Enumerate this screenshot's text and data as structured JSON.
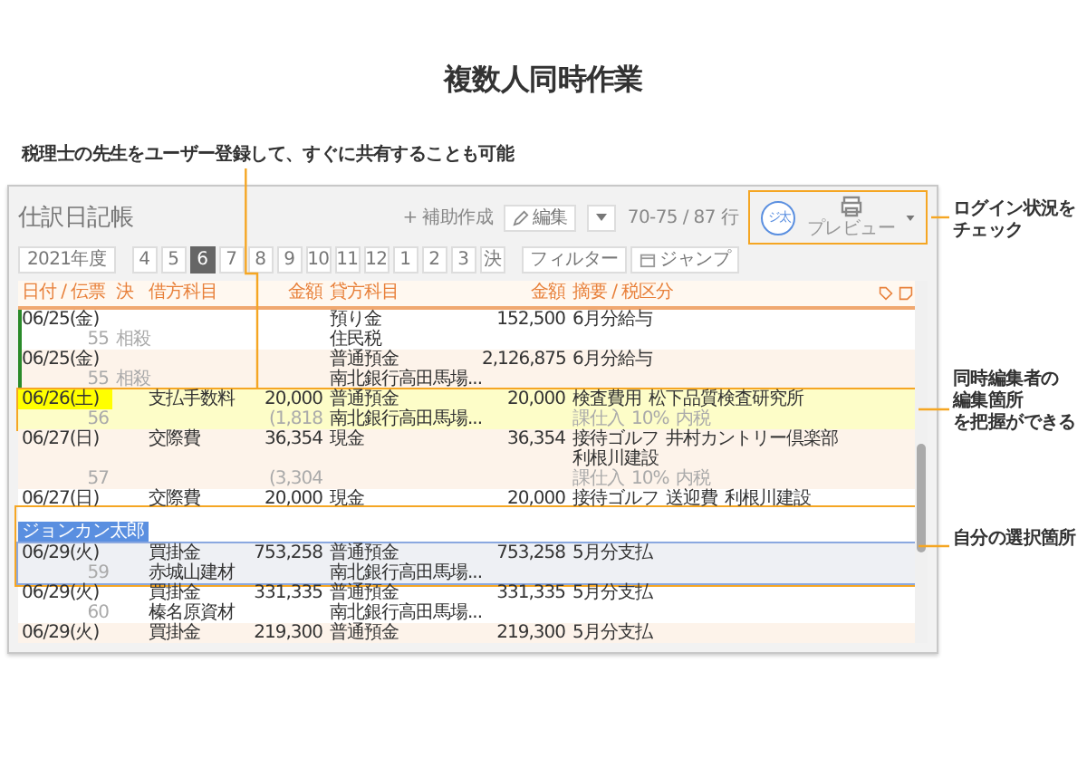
{
  "title": "複数人同時作業",
  "note": "税理士の先生をユーザー登録して、すぐに共有することも可能",
  "callouts": [
    {
      "kind": "login",
      "lines": [
        "ログイン状況を",
        "チェック"
      ]
    },
    {
      "kind": "other",
      "lines": [
        "同時編集者の",
        "編集箇所",
        "を把握ができる"
      ]
    },
    {
      "kind": "self",
      "lines": [
        "自分の選択箇所"
      ]
    }
  ],
  "window": {
    "title": "仕訳日記帳",
    "user_avatar": "ジ太",
    "preview": "プレビュー",
    "add_sub": "+ 補助作成",
    "edit": "編集",
    "row_range": "70-75 / 87 行",
    "fiscal_year": "2021年度",
    "periods": [
      {
        "label": "4",
        "selected": false
      },
      {
        "label": "5",
        "selected": false
      },
      {
        "label": "6",
        "selected": true
      },
      {
        "label": "7",
        "selected": false
      },
      {
        "label": "8",
        "selected": false
      },
      {
        "label": "9",
        "selected": false
      },
      {
        "label": "10",
        "selected": false
      },
      {
        "label": "11",
        "selected": false
      },
      {
        "label": "12",
        "selected": false
      },
      {
        "label": "1",
        "selected": false
      },
      {
        "label": "2",
        "selected": false
      },
      {
        "label": "3",
        "selected": false
      },
      {
        "label": "決",
        "selected": false
      }
    ],
    "filter": "フィルター",
    "jump": "ジャンプ"
  },
  "table": {
    "columns": [
      "日付 / 伝票",
      "決",
      "借方科目",
      "金額",
      "貸方科目",
      "金額",
      "摘要 / 税区分"
    ],
    "entries": [
      {
        "date": "06/25(金)",
        "slip": "55",
        "settle": "相殺",
        "credit": "預り金",
        "credit_amount": "152,500",
        "credit_sub": "住民税",
        "memo": [
          "6月分給与"
        ],
        "edited_by_other": false,
        "selected": false,
        "left_marker": true
      },
      {
        "date": "06/25(金)",
        "slip": "55",
        "settle": "相殺",
        "credit": "普通預金",
        "credit_amount": "2,126,875",
        "credit_sub": "南北銀行高田馬場...",
        "memo": [
          "6月分給与"
        ],
        "edited_by_other": false,
        "selected": false,
        "left_marker": true
      },
      {
        "date": "06/26(土)",
        "slip": "56",
        "debit": "支払手数料",
        "debit_amount": "20,000",
        "debit_tax": "(1,818",
        "credit": "普通預金",
        "credit_amount": "20,000",
        "credit_sub": "南北銀行高田馬場...",
        "memo": [
          "検査費用",
          "松下品質検査研究所"
        ],
        "tax": [
          "課仕入",
          "10%",
          "内税"
        ],
        "edited_by_other": true,
        "selected": false,
        "left_marker": false
      },
      {
        "date": "06/27(日)",
        "slip": "57",
        "debit": "交際費",
        "debit_amount": "36,354",
        "debit_tax": "(3,304",
        "credit": "現金",
        "credit_amount": "36,354",
        "memo": [
          "接待ゴルフ",
          "井村カントリー倶楽部",
          "利根川建設"
        ],
        "tax": [
          "課仕入",
          "10%",
          "内税"
        ],
        "edited_by_other": false,
        "selected": false,
        "left_marker": false
      },
      {
        "date": "06/27(日)",
        "debit": "交際費",
        "debit_amount": "20,000",
        "credit": "現金",
        "credit_amount": "20,000",
        "memo": [
          "接待ゴルフ",
          "送迎費",
          "利根川建設"
        ],
        "edited_by_other": false,
        "selected": false,
        "left_marker": false
      },
      {
        "date": "06/29(火)",
        "slip": "59",
        "debit": "買掛金",
        "debit_amount": "753,258",
        "debit_sub": "赤城山建材",
        "credit": "普通預金",
        "credit_amount": "753,258",
        "credit_sub": "南北銀行高田馬場...",
        "memo": [
          "5月分支払"
        ],
        "edited_by_other": false,
        "selected": true,
        "editor_label": "ジョンカン太郎",
        "left_marker": false
      },
      {
        "date": "06/29(火)",
        "slip": "60",
        "debit": "買掛金",
        "debit_amount": "331,335",
        "debit_sub": "榛名原資材",
        "credit": "普通預金",
        "credit_amount": "331,335",
        "credit_sub": "南北銀行高田馬場...",
        "memo": [
          "5月分支払"
        ],
        "edited_by_other": false,
        "selected": false,
        "left_marker": false
      },
      {
        "date": "06/29(火)",
        "debit": "買掛金",
        "debit_amount": "219,300",
        "credit": "普通預金",
        "credit_amount": "219,300",
        "memo": [
          "5月分支払"
        ],
        "edited_by_other": false,
        "selected": false,
        "left_marker": false
      }
    ]
  }
}
